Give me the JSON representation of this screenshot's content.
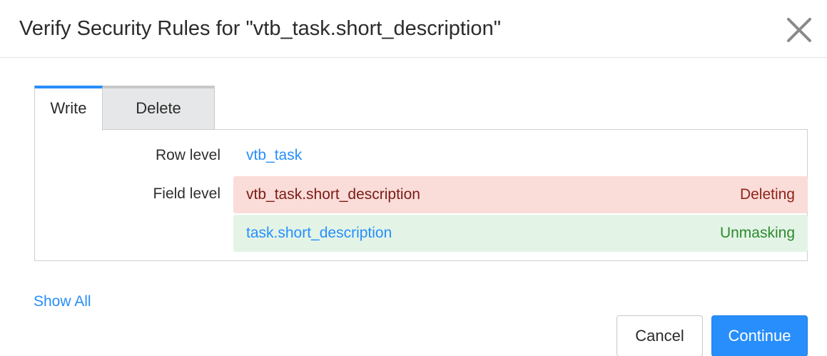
{
  "dialog": {
    "title": "Verify Security Rules for \"vtb_task.short_description\"",
    "close_icon": "close-icon"
  },
  "tabs": [
    {
      "label": "Write",
      "selected": true
    },
    {
      "label": "Delete",
      "selected": false
    }
  ],
  "rules": {
    "row_level_label": "Row level",
    "row_level_rule": "vtb_task",
    "field_level_label": "Field level",
    "field_rules": [
      {
        "name": "vtb_task.short_description",
        "status": "Deleting"
      },
      {
        "name": "task.short_description",
        "status": "Unmasking"
      }
    ]
  },
  "show_all_label": "Show All",
  "buttons": {
    "cancel": "Cancel",
    "continue": "Continue"
  },
  "colors": {
    "accent": "#278efc",
    "deleting_bg": "#fadcd9",
    "deleting_text": "#8e2417",
    "unmasking_bg": "#e3f4e6",
    "unmasking_text": "#2d8a2d"
  }
}
